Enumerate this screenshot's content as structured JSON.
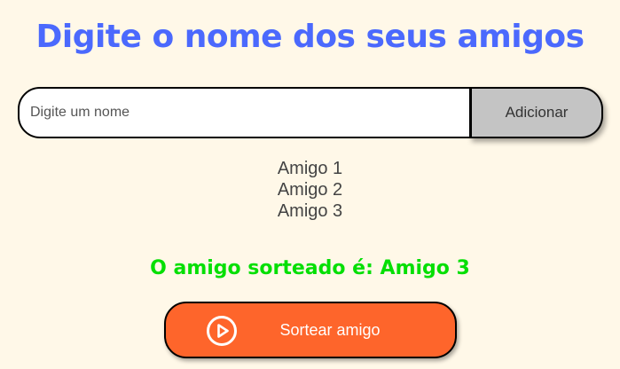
{
  "header": {
    "title": "Digite o nome dos seus amigos"
  },
  "input": {
    "placeholder": "Digite um nome",
    "value": ""
  },
  "add_button": {
    "label": "Adicionar"
  },
  "friends": [
    "Amigo 1",
    "Amigo 2",
    "Amigo 3"
  ],
  "result": {
    "text": "O amigo sorteado é: Amigo 3"
  },
  "draw_button": {
    "label": "Sortear amigo",
    "icon": "play-circle-icon"
  },
  "colors": {
    "background": "#fff8e8",
    "title": "#4b69fd",
    "result": "#05df05",
    "draw_button": "#fe652b",
    "add_button": "#c4c4c4"
  }
}
